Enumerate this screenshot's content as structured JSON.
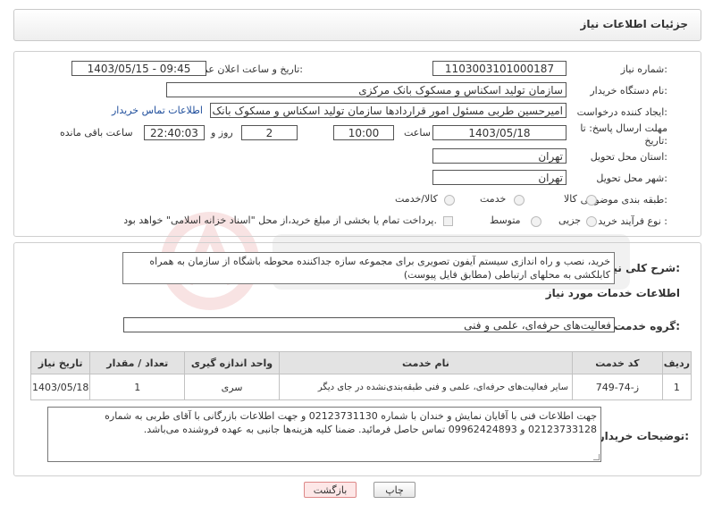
{
  "header": {
    "title": "جزئیات اطلاعات نیاز"
  },
  "form": {
    "need_number_label": "شماره نیاز:",
    "need_number": "1103003101000187",
    "announce_label": "تاریخ و ساعت اعلان عمومی:",
    "announce_value": "1403/05/15 - 09:45",
    "buyer_org_label": "نام دستگاه خریدار:",
    "buyer_org": "سازمان تولید اسکناس و مسکوک بانک مرکزی",
    "creator_label": "ایجاد کننده درخواست:",
    "creator": "امیرحسین طربی مسئول امور قراردادها سازمان تولید اسکناس و مسکوک بانک مرکزی",
    "buyer_contact_link": "اطلاعات تماس خریدار",
    "deadline_label_1": "مهلت ارسال پاسخ: تا",
    "deadline_label_2": "تاریخ:",
    "deadline_date": "1403/05/18",
    "time_label": "ساعت",
    "deadline_time": "10:00",
    "days_value": "2",
    "days_label": "روز و",
    "remaining_time": "22:40:03",
    "remaining_label": "ساعت باقی مانده",
    "province_label": "استان محل تحویل:",
    "province": "تهران",
    "city_label": "شهر محل تحویل:",
    "city": "تهران",
    "category_label": "طبقه بندی موضوعی:",
    "category_options": [
      "کالا",
      "خدمت",
      "کالا/خدمت"
    ],
    "process_label": "نوع فرآیند خرید :",
    "process_options": [
      "جزیی",
      "متوسط"
    ],
    "payment_note": "پرداخت تمام یا بخشی از مبلغ خرید،از محل \"اسناد خزانه اسلامی\" خواهد بود."
  },
  "summary": {
    "label": "شرح کلی نیاز:",
    "text": "خرید، نصب و راه اندازی سیستم آیفون تصویری برای مجموعه سازه جداکننده محوطه باشگاه از سازمان به همراه کابلکشی به محلهای ارتباطی (مطابق فایل پیوست)"
  },
  "services": {
    "section_title": "اطلاعات خدمات مورد نیاز",
    "group_label": "گروه خدمت:",
    "group_value": "فعالیت‌های حرفه‌ای، علمی و فنی",
    "table": {
      "headers": [
        "ردیف",
        "کد خدمت",
        "نام خدمت",
        "واحد اندازه گیری",
        "تعداد / مقدار",
        "تاریخ نیاز"
      ],
      "rows": [
        [
          "1",
          "ز-74-749",
          "سایر فعالیت‌های حرفه‌ای، علمی و فنی طبقه‌بندی‌نشده در جای دیگر",
          "سری",
          "1",
          "1403/05/18"
        ]
      ]
    }
  },
  "buyer_notes": {
    "label": "توضیحات خریدار:",
    "text": "جهت اطلاعات فنی با آقایان نمایش و خندان با شماره 02123731130 و جهت اطلاعات بازرگانی با آقای طربی به شماره 02123733128 و 09962424893 تماس حاصل فرمائید. ضمنا کلیه هزینه‌ها جانبی به عهده فروشنده می‌باشد."
  },
  "footer": {
    "print_label": "چاپ",
    "back_label": "بازگشت"
  },
  "colors": {
    "link": "#1f4e9c",
    "back_button_bg": "#fde7e7"
  }
}
